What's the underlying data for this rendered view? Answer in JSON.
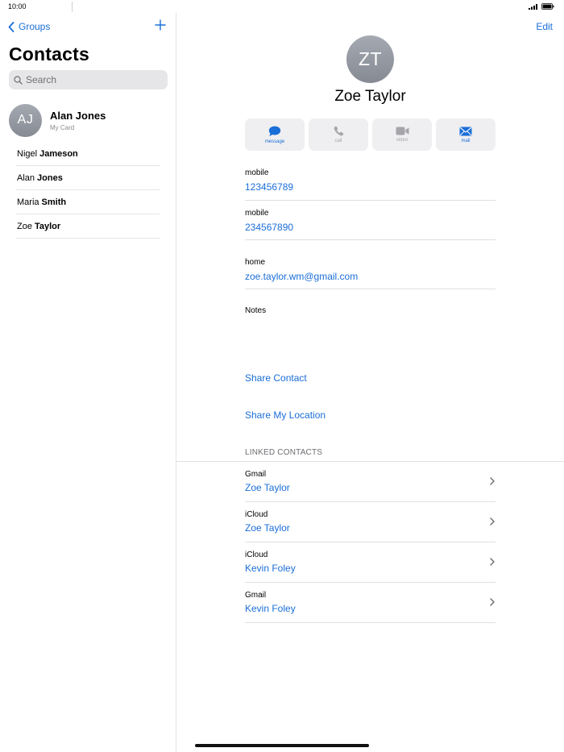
{
  "status_bar": {
    "time": "10:00"
  },
  "sidebar": {
    "back_label": "Groups",
    "title": "Contacts",
    "search_placeholder": "Search",
    "my_card": {
      "initials": "AJ",
      "name": "Alan Jones",
      "subtitle": "My Card"
    },
    "contacts": [
      {
        "first": "Nigel",
        "last": "Jameson"
      },
      {
        "first": "Alan",
        "last": "Jones"
      },
      {
        "first": "Maria",
        "last": "Smith"
      },
      {
        "first": "Zoe",
        "last": "Taylor"
      }
    ]
  },
  "detail": {
    "edit_label": "Edit",
    "initials": "ZT",
    "name": "Zoe Taylor",
    "actions": [
      {
        "label": "message",
        "icon": "message-icon",
        "enabled": true
      },
      {
        "label": "call",
        "icon": "phone-icon",
        "enabled": false
      },
      {
        "label": "video",
        "icon": "video-icon",
        "enabled": false
      },
      {
        "label": "mail",
        "icon": "mail-icon",
        "enabled": true
      }
    ],
    "fields": [
      {
        "label": "mobile",
        "value": "123456789"
      },
      {
        "label": "mobile",
        "value": "234567890"
      },
      {
        "label": "home",
        "value": "zoe.taylor.wm@gmail.com"
      }
    ],
    "notes_label": "Notes",
    "share_contact": "Share Contact",
    "share_location": "Share My Location",
    "linked_header": "LINKED CONTACTS",
    "linked": [
      {
        "source": "Gmail",
        "name": "Zoe Taylor"
      },
      {
        "source": "iCloud",
        "name": "Zoe Taylor"
      },
      {
        "source": "iCloud",
        "name": "Kevin Foley"
      },
      {
        "source": "Gmail",
        "name": "Kevin Foley"
      }
    ]
  },
  "colors": {
    "accent": "#1a6ed8",
    "avatar": "#979ba4",
    "disabled": "#a6a6aa"
  }
}
